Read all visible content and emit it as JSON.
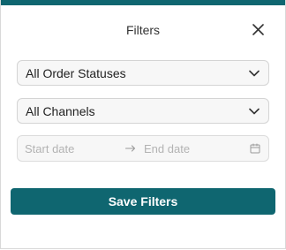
{
  "colors": {
    "accent": "#0f6670"
  },
  "header": {
    "title": "Filters",
    "close_icon": "close-icon"
  },
  "filters": {
    "order_status": {
      "value": "All Order Statuses",
      "icon": "chevron-down-icon"
    },
    "channel": {
      "value": "All Channels",
      "icon": "chevron-down-icon"
    },
    "date_range": {
      "start_placeholder": "Start date",
      "end_placeholder": "End date",
      "separator_icon": "arrow-right-icon",
      "calendar_icon": "calendar-icon"
    }
  },
  "actions": {
    "save_label": "Save Filters"
  }
}
